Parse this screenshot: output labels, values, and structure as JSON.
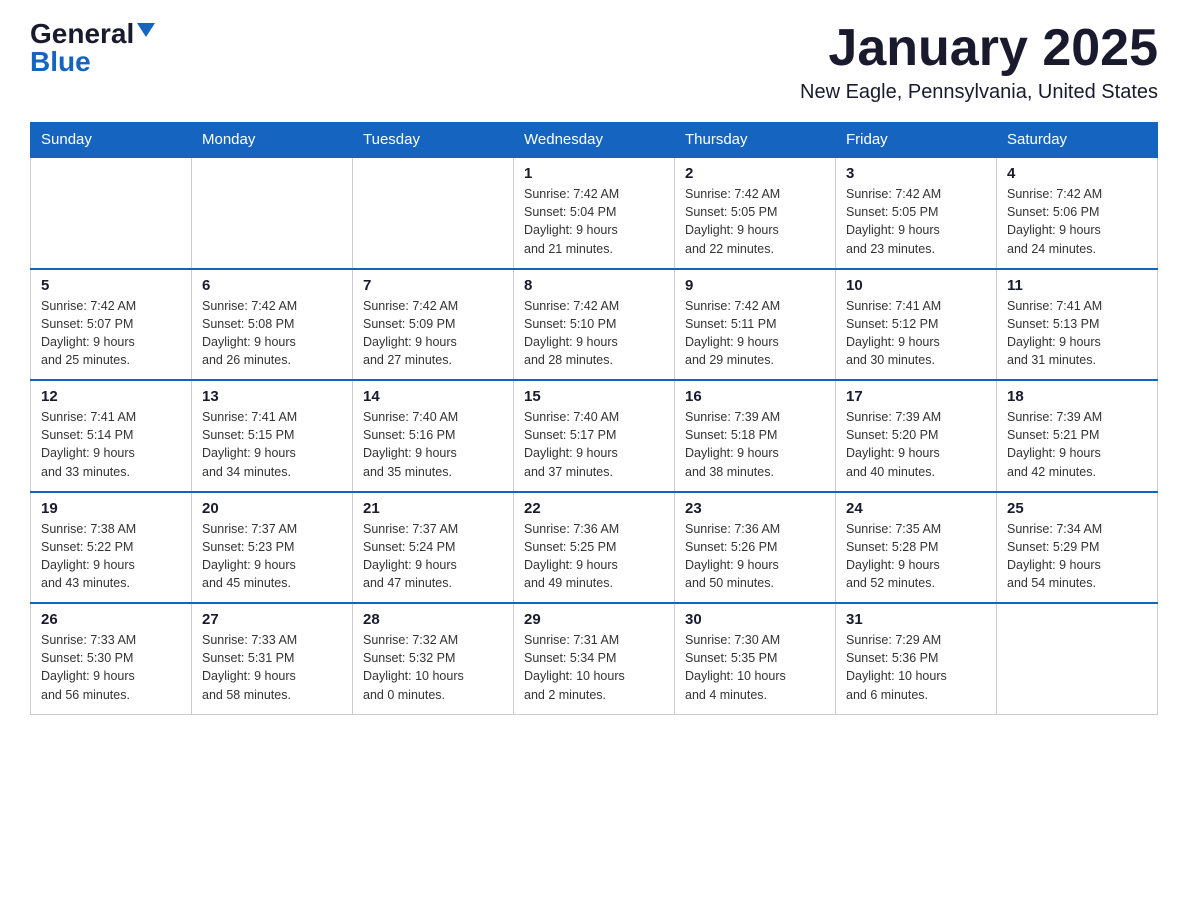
{
  "header": {
    "logo_general": "General",
    "logo_blue": "Blue",
    "month_title": "January 2025",
    "location": "New Eagle, Pennsylvania, United States"
  },
  "days_of_week": [
    "Sunday",
    "Monday",
    "Tuesday",
    "Wednesday",
    "Thursday",
    "Friday",
    "Saturday"
  ],
  "weeks": [
    [
      {
        "day": "",
        "info": ""
      },
      {
        "day": "",
        "info": ""
      },
      {
        "day": "",
        "info": ""
      },
      {
        "day": "1",
        "info": "Sunrise: 7:42 AM\nSunset: 5:04 PM\nDaylight: 9 hours\nand 21 minutes."
      },
      {
        "day": "2",
        "info": "Sunrise: 7:42 AM\nSunset: 5:05 PM\nDaylight: 9 hours\nand 22 minutes."
      },
      {
        "day": "3",
        "info": "Sunrise: 7:42 AM\nSunset: 5:05 PM\nDaylight: 9 hours\nand 23 minutes."
      },
      {
        "day": "4",
        "info": "Sunrise: 7:42 AM\nSunset: 5:06 PM\nDaylight: 9 hours\nand 24 minutes."
      }
    ],
    [
      {
        "day": "5",
        "info": "Sunrise: 7:42 AM\nSunset: 5:07 PM\nDaylight: 9 hours\nand 25 minutes."
      },
      {
        "day": "6",
        "info": "Sunrise: 7:42 AM\nSunset: 5:08 PM\nDaylight: 9 hours\nand 26 minutes."
      },
      {
        "day": "7",
        "info": "Sunrise: 7:42 AM\nSunset: 5:09 PM\nDaylight: 9 hours\nand 27 minutes."
      },
      {
        "day": "8",
        "info": "Sunrise: 7:42 AM\nSunset: 5:10 PM\nDaylight: 9 hours\nand 28 minutes."
      },
      {
        "day": "9",
        "info": "Sunrise: 7:42 AM\nSunset: 5:11 PM\nDaylight: 9 hours\nand 29 minutes."
      },
      {
        "day": "10",
        "info": "Sunrise: 7:41 AM\nSunset: 5:12 PM\nDaylight: 9 hours\nand 30 minutes."
      },
      {
        "day": "11",
        "info": "Sunrise: 7:41 AM\nSunset: 5:13 PM\nDaylight: 9 hours\nand 31 minutes."
      }
    ],
    [
      {
        "day": "12",
        "info": "Sunrise: 7:41 AM\nSunset: 5:14 PM\nDaylight: 9 hours\nand 33 minutes."
      },
      {
        "day": "13",
        "info": "Sunrise: 7:41 AM\nSunset: 5:15 PM\nDaylight: 9 hours\nand 34 minutes."
      },
      {
        "day": "14",
        "info": "Sunrise: 7:40 AM\nSunset: 5:16 PM\nDaylight: 9 hours\nand 35 minutes."
      },
      {
        "day": "15",
        "info": "Sunrise: 7:40 AM\nSunset: 5:17 PM\nDaylight: 9 hours\nand 37 minutes."
      },
      {
        "day": "16",
        "info": "Sunrise: 7:39 AM\nSunset: 5:18 PM\nDaylight: 9 hours\nand 38 minutes."
      },
      {
        "day": "17",
        "info": "Sunrise: 7:39 AM\nSunset: 5:20 PM\nDaylight: 9 hours\nand 40 minutes."
      },
      {
        "day": "18",
        "info": "Sunrise: 7:39 AM\nSunset: 5:21 PM\nDaylight: 9 hours\nand 42 minutes."
      }
    ],
    [
      {
        "day": "19",
        "info": "Sunrise: 7:38 AM\nSunset: 5:22 PM\nDaylight: 9 hours\nand 43 minutes."
      },
      {
        "day": "20",
        "info": "Sunrise: 7:37 AM\nSunset: 5:23 PM\nDaylight: 9 hours\nand 45 minutes."
      },
      {
        "day": "21",
        "info": "Sunrise: 7:37 AM\nSunset: 5:24 PM\nDaylight: 9 hours\nand 47 minutes."
      },
      {
        "day": "22",
        "info": "Sunrise: 7:36 AM\nSunset: 5:25 PM\nDaylight: 9 hours\nand 49 minutes."
      },
      {
        "day": "23",
        "info": "Sunrise: 7:36 AM\nSunset: 5:26 PM\nDaylight: 9 hours\nand 50 minutes."
      },
      {
        "day": "24",
        "info": "Sunrise: 7:35 AM\nSunset: 5:28 PM\nDaylight: 9 hours\nand 52 minutes."
      },
      {
        "day": "25",
        "info": "Sunrise: 7:34 AM\nSunset: 5:29 PM\nDaylight: 9 hours\nand 54 minutes."
      }
    ],
    [
      {
        "day": "26",
        "info": "Sunrise: 7:33 AM\nSunset: 5:30 PM\nDaylight: 9 hours\nand 56 minutes."
      },
      {
        "day": "27",
        "info": "Sunrise: 7:33 AM\nSunset: 5:31 PM\nDaylight: 9 hours\nand 58 minutes."
      },
      {
        "day": "28",
        "info": "Sunrise: 7:32 AM\nSunset: 5:32 PM\nDaylight: 10 hours\nand 0 minutes."
      },
      {
        "day": "29",
        "info": "Sunrise: 7:31 AM\nSunset: 5:34 PM\nDaylight: 10 hours\nand 2 minutes."
      },
      {
        "day": "30",
        "info": "Sunrise: 7:30 AM\nSunset: 5:35 PM\nDaylight: 10 hours\nand 4 minutes."
      },
      {
        "day": "31",
        "info": "Sunrise: 7:29 AM\nSunset: 5:36 PM\nDaylight: 10 hours\nand 6 minutes."
      },
      {
        "day": "",
        "info": ""
      }
    ]
  ]
}
